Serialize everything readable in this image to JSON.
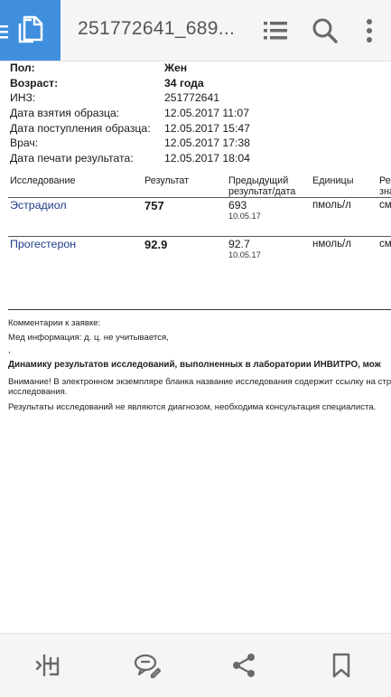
{
  "toolbar": {
    "title": "251772641_689...",
    "icons": [
      "document-icon",
      "list-icon",
      "search-icon",
      "more-vertical-icon"
    ]
  },
  "patient": {
    "sex_label": "Пол:",
    "sex_value": "Жен",
    "age_label": "Возраст:",
    "age_value": "34 года",
    "inz_label": "ИНЗ:",
    "inz_value": "251772641",
    "sample_taken_label": "Дата взятия образца:",
    "sample_taken_value": "12.05.2017 11:07",
    "sample_received_label": "Дата поступления образца:",
    "sample_received_value": "12.05.2017 15:47",
    "doctor_label": "Врач:",
    "doctor_value": "12.05.2017 17:38",
    "print_date_label": "Дата печати результата:",
    "print_date_value": "12.05.2017 18:04"
  },
  "table": {
    "headers": {
      "test": "Исследование",
      "result": "Результат",
      "previous_1": "Предыдущий",
      "previous_2": "результат/дата",
      "units": "Единицы",
      "ref_1": "Ре",
      "ref_2": "зна"
    },
    "rows": [
      {
        "test": "Эстрадиол",
        "result": "757",
        "previous": "693",
        "previous_date": "10.05.17",
        "units": "пмоль/л",
        "ref": "см"
      },
      {
        "test": "Прогестерон",
        "result": "92.9",
        "previous": "92.7",
        "previous_date": "10.05.17",
        "units": "нмоль/л",
        "ref": "см"
      }
    ]
  },
  "notes": {
    "comments": "Комментарии к заявке:",
    "med_info": "Мед информация: д. ц. не учитывается,",
    "comma": ",",
    "dynamics": "Динамику результатов исследований, выполненных в лаборатории ИНВИТРО, мож",
    "attention_1": "Внимание! В электронном экземпляре бланка название исследования содержит ссылку на стр",
    "attention_2": "исследования.",
    "disclaimer": "Результаты исследований не являются диагнозом, необходима консультация специалиста."
  },
  "bottombar": {
    "icons": [
      "compare-icon",
      "comment-icon",
      "share-icon",
      "bookmark-icon"
    ]
  },
  "colors": {
    "accent": "#3f8fde",
    "link": "#1d3a8a",
    "bar": "#f5f5f5",
    "icon": "#6a6a6a"
  }
}
